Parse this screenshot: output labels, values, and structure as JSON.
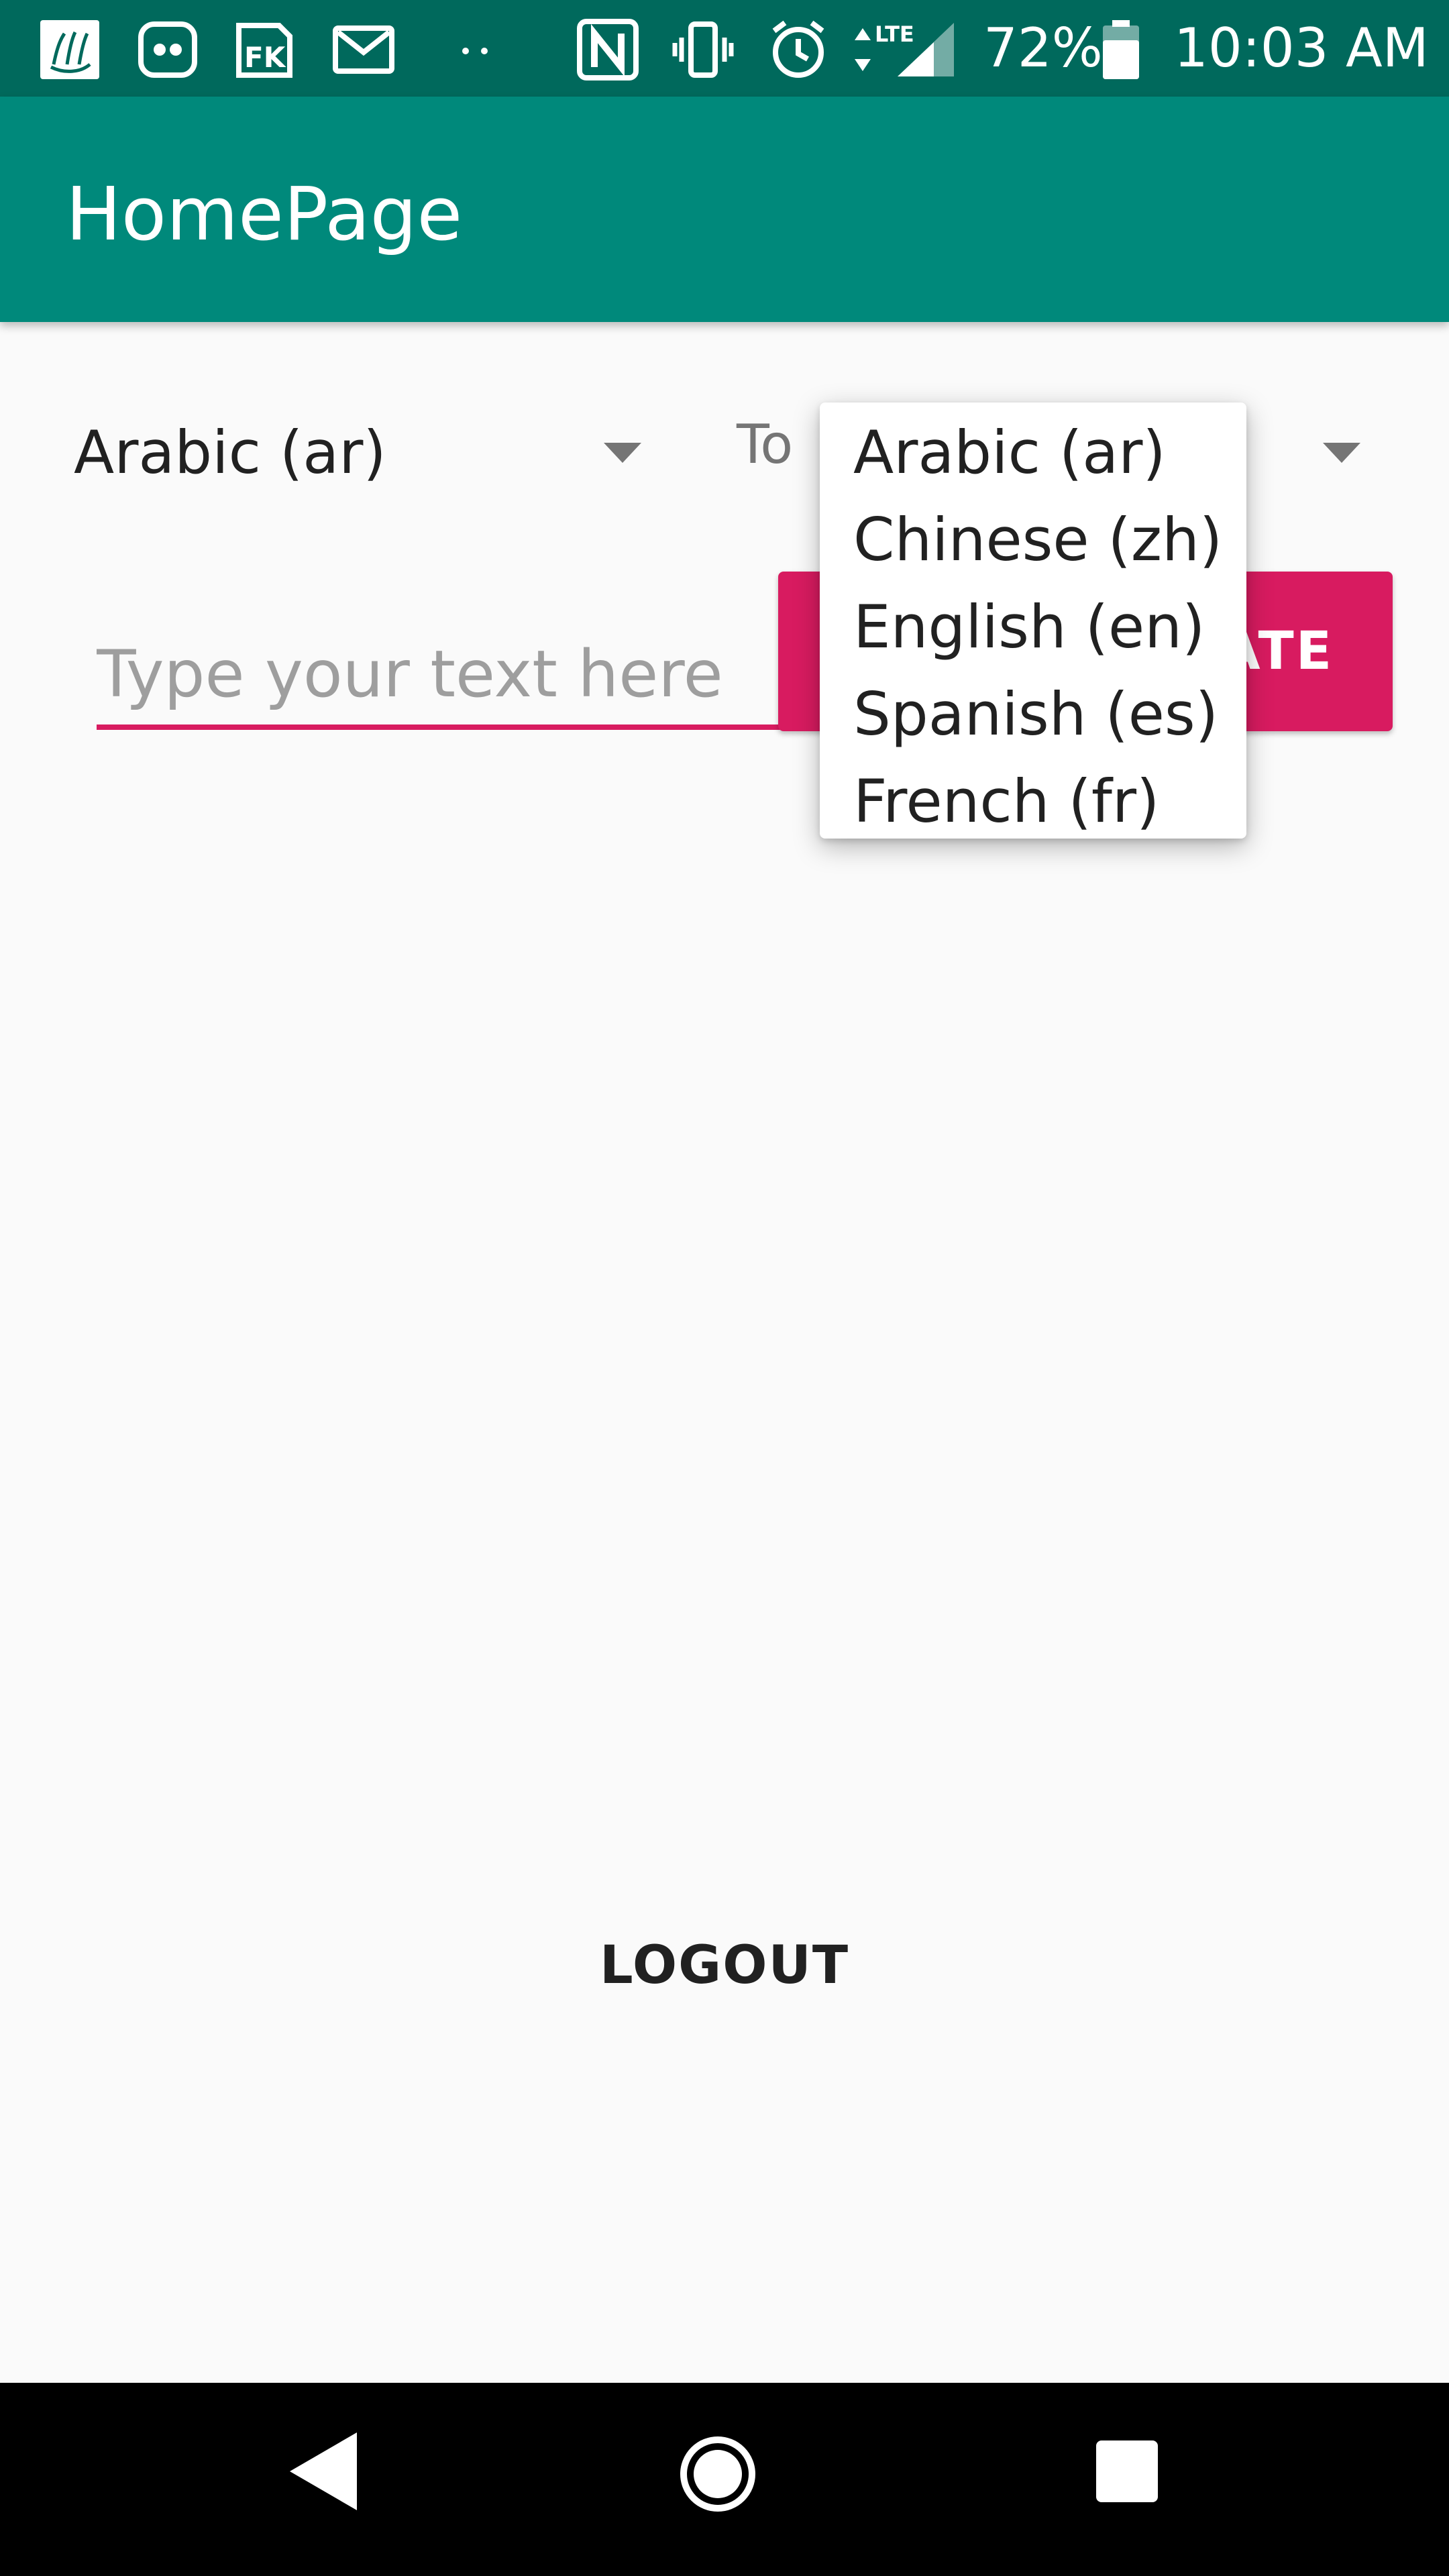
{
  "status_bar": {
    "battery": "72%",
    "time": "10:03 AM",
    "network": "LTE",
    "icons": [
      "calligraphy-app-icon",
      "dots-app-icon",
      "fk-app-icon",
      "gmail-icon",
      "more-dots-icon",
      "nfc-icon",
      "vibrate-icon",
      "alarm-icon",
      "lte-icon",
      "signal-icon",
      "battery-icon"
    ]
  },
  "app_bar": {
    "title": "HomePage"
  },
  "translator": {
    "from_language": "Arabic (ar)",
    "to_label": "To",
    "input_placeholder": "Type your text here",
    "input_value": "",
    "translate_button_visible": "ATE",
    "dropdown_options": [
      "Arabic (ar)",
      "Chinese (zh)",
      "English (en)",
      "Spanish (es)",
      "French (fr)"
    ]
  },
  "footer": {
    "logout_label": "LOGOUT"
  },
  "colors": {
    "status_bar": "#00695c",
    "app_bar": "#00897b",
    "accent": "#d81b60",
    "background": "#fafafa"
  }
}
